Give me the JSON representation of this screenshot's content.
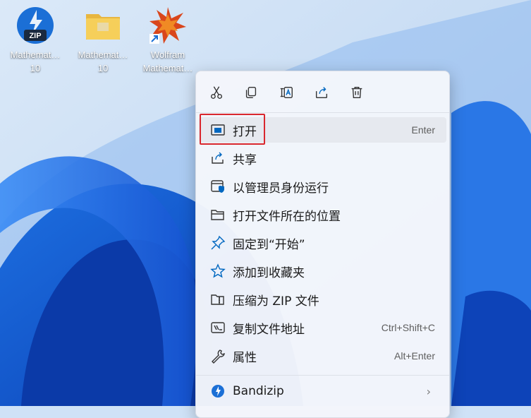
{
  "desktop": {
    "icons": [
      {
        "label": "Mathemat…\n10",
        "icon": "zip-archive-icon"
      },
      {
        "label": "Mathemat…\n10",
        "icon": "folder-icon"
      },
      {
        "label": "Wolfram\nMathemat…",
        "icon": "wolfram-mathematica-icon"
      }
    ]
  },
  "context_menu": {
    "quick_actions": [
      {
        "name": "cut",
        "icon": "scissors-icon"
      },
      {
        "name": "copy",
        "icon": "copy-icon"
      },
      {
        "name": "rename",
        "icon": "rename-icon"
      },
      {
        "name": "share",
        "icon": "share-icon"
      },
      {
        "name": "delete",
        "icon": "trash-icon"
      }
    ],
    "items": [
      {
        "label": "打开",
        "shortcut": "Enter",
        "icon": "open-window-icon",
        "highlighted": true
      },
      {
        "label": "共享",
        "shortcut": "",
        "icon": "share-icon"
      },
      {
        "label": "以管理员身份运行",
        "shortcut": "",
        "icon": "shield-window-icon"
      },
      {
        "label": "打开文件所在的位置",
        "shortcut": "",
        "icon": "folder-open-icon"
      },
      {
        "label": "固定到“开始”",
        "shortcut": "",
        "icon": "pin-icon"
      },
      {
        "label": "添加到收藏夹",
        "shortcut": "",
        "icon": "star-icon"
      },
      {
        "label": "压缩为 ZIP 文件",
        "shortcut": "",
        "icon": "zip-folder-icon"
      },
      {
        "label": "复制文件地址",
        "shortcut": "Ctrl+Shift+C",
        "icon": "path-copy-icon"
      },
      {
        "label": "属性",
        "shortcut": "Alt+Enter",
        "icon": "wrench-icon"
      },
      {
        "label": "Bandizip",
        "shortcut": "",
        "icon": "bandizip-icon",
        "has_submenu": true
      }
    ]
  },
  "colors": {
    "accent": "#0067c0",
    "highlight_box": "#d9272e"
  }
}
